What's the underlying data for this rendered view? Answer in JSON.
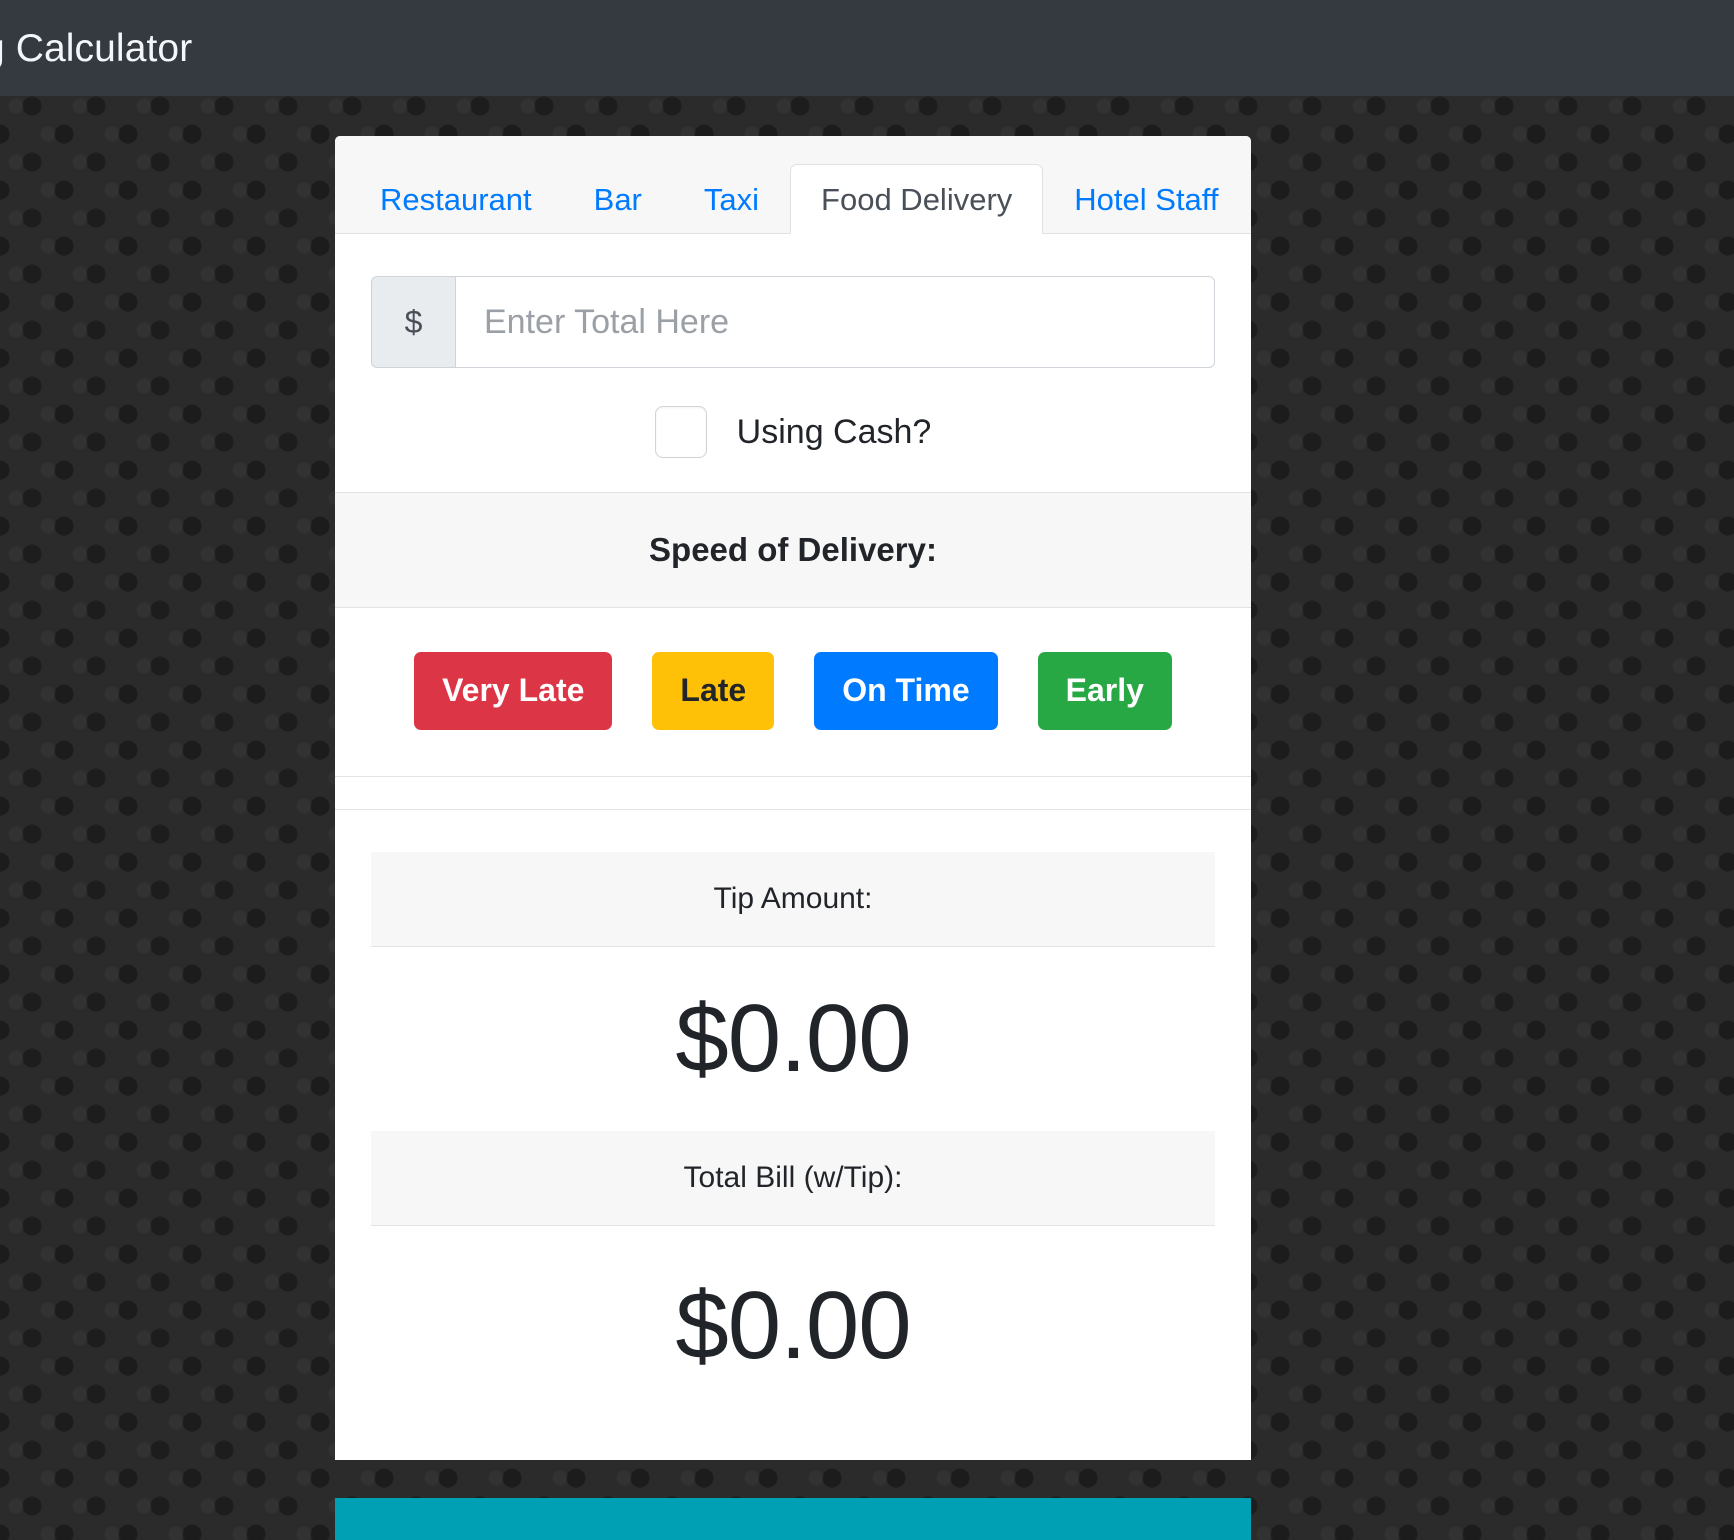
{
  "navbar": {
    "brand": "g Calculator",
    "background": "#343a40"
  },
  "tabs": [
    {
      "label": "Restaurant",
      "active": false
    },
    {
      "label": "Bar",
      "active": false
    },
    {
      "label": "Taxi",
      "active": false
    },
    {
      "label": "Food Delivery",
      "active": true
    },
    {
      "label": "Hotel Staff",
      "active": false
    }
  ],
  "total_input": {
    "prefix": "$",
    "placeholder": "Enter Total Here",
    "value": ""
  },
  "cash_option": {
    "label": "Using Cash?",
    "checked": false
  },
  "speed_section": {
    "title": "Speed of Delivery:",
    "buttons": [
      {
        "label": "Very Late",
        "color": "#dc3545",
        "text_color": "#ffffff"
      },
      {
        "label": "Late",
        "color": "#ffc107",
        "text_color": "#212529"
      },
      {
        "label": "On Time",
        "color": "#007bff",
        "text_color": "#ffffff"
      },
      {
        "label": "Early",
        "color": "#28a745",
        "text_color": "#ffffff"
      }
    ]
  },
  "results": {
    "tip_label": "Tip Amount:",
    "tip_value": "$0.00",
    "total_label": "Total Bill (w/Tip):",
    "total_value": "$0.00"
  },
  "footer": {
    "color": "#00a0b4"
  }
}
